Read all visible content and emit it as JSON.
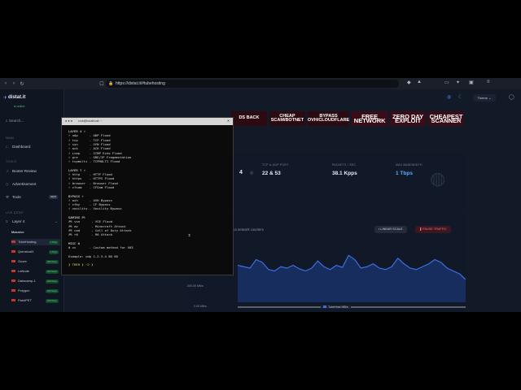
{
  "browser": {
    "url": "https://distat.it/#tubehosting",
    "theme_label": "Theme"
  },
  "sidebar": {
    "logo": "distat.it",
    "status": "online",
    "search_placeholder": "Search...",
    "sections": {
      "main": "MAIN",
      "tools": "TOOLS",
      "live": "LIVE DSTAT"
    },
    "dashboard": "Dashboard",
    "booter_review": "Booter Review",
    "advertisement": "Advertisement",
    "tools": "Tools",
    "tools_badge": "NEW",
    "layer4": "Layer 4",
    "massive": "Massive",
    "items": [
      {
        "label": "TubeHosting",
        "tag": "1 Tbps"
      },
      {
        "label": "QuinstoalX",
        "tag": "1 Tbps"
      },
      {
        "label": "Ocore",
        "tag": "400 Gbps"
      },
      {
        "label": "LaNode",
        "tag": "200 Gbps"
      },
      {
        "label": "Datacamp-1",
        "tag": "100 Gbps"
      },
      {
        "label": "Polygon",
        "tag": "100 Gbps"
      },
      {
        "label": "PashPET",
        "tag": "100 Gbps"
      }
    ]
  },
  "banner": [
    "DS BACK",
    "CHEAP SCAM/BOTNET",
    "BYPASS OVH/CLOUDFLARE",
    "FREE NETWORK",
    "ZERO DAY EXPLOIT",
    "CHEAPEST SCANNER"
  ],
  "stats": [
    {
      "label": "TCP & UDP PORT",
      "value": "22 & 53"
    },
    {
      "label": "PACKETS / SEC",
      "value": "38.1 Kpps"
    },
    {
      "label": "MAX BANDWIDTH",
      "value": "1 Tbps"
    }
  ],
  "stats_partial_value": "4",
  "chart_card": {
    "subtitle": "nca network counters",
    "linear_scale": "LINEAR SCALE",
    "pause_traffic": "PAUSE TRAFFIC",
    "legend": "TubeHost MB/s"
  },
  "chart_data": {
    "type": "area",
    "ylabel_ticks": [
      "200.00 Mb/s",
      "0.00 Mb/s"
    ],
    "series": [
      {
        "name": "TubeHost MB/s",
        "values": [
          260,
          250,
          240,
          300,
          280,
          230,
          220,
          250,
          240,
          260,
          235,
          220,
          240,
          290,
          250,
          230,
          260,
          245,
          330,
          300,
          240,
          250,
          270,
          240,
          230,
          250,
          310,
          270,
          240,
          230,
          250,
          270,
          300,
          280,
          240,
          220,
          200,
          160
        ]
      }
    ]
  },
  "terminal": {
    "title": "root@localhost: ~",
    "lines": [
      {
        "t": "LAYER 4 ⚡",
        "c": "hdr"
      },
      {
        "t": "⚡ udp      - UDP Flood"
      },
      {
        "t": "⚡ tcp      - TCP Flood"
      },
      {
        "t": "⚡ syn      - SYN Flood"
      },
      {
        "t": "⚡ ack      - ACK Flood"
      },
      {
        "t": "⚡ icmp     - ICMP Echo Flood"
      },
      {
        "t": "⚡ gre      - GRE/IP Fragmentation"
      },
      {
        "t": "⚡ tcpmulti - TCPMULTI Flood"
      },
      {
        "t": " "
      },
      {
        "t": "LAYER 7 ⚡",
        "c": "hdr"
      },
      {
        "t": "⚡ http     - HTTP Flood"
      },
      {
        "t": "⚡ https    - HTTPS Flood"
      },
      {
        "t": "⚡ browser  - Browser Flood"
      },
      {
        "t": "⚡ cfsam    - CFSam Flood"
      },
      {
        "t": " "
      },
      {
        "t": "BYPASS ⚡",
        "c": "hdr"
      },
      {
        "t": "⚡ ovh      - OVH Bypass"
      },
      {
        "t": "⚡ cfby     - CF Bypass"
      },
      {
        "t": "⚡ voxility - Voxility Bypass"
      },
      {
        "t": " "
      },
      {
        "t": "GAMING 🎮",
        "c": "hdr"
      },
      {
        "t": "🎮 vse      - VSE Flood"
      },
      {
        "t": "🎮 mc       - Minecraft Attack"
      },
      {
        "t": "🎮 cod      - Call of Duty Attack"
      },
      {
        "t": "🎮 r6       - R6 Attack"
      },
      {
        "t": " "
      },
      {
        "t": "MISC ⚙",
        "c": "hdr"
      },
      {
        "t": "⚙ vc       - Custom method for X63"
      },
      {
        "t": " "
      },
      {
        "t": "Example: udp 1.2.3.4 80 60"
      },
      {
        "t": " "
      },
      {
        "t": "❯ THEH ❯ ~2 ❯",
        "c": "yl"
      }
    ]
  }
}
